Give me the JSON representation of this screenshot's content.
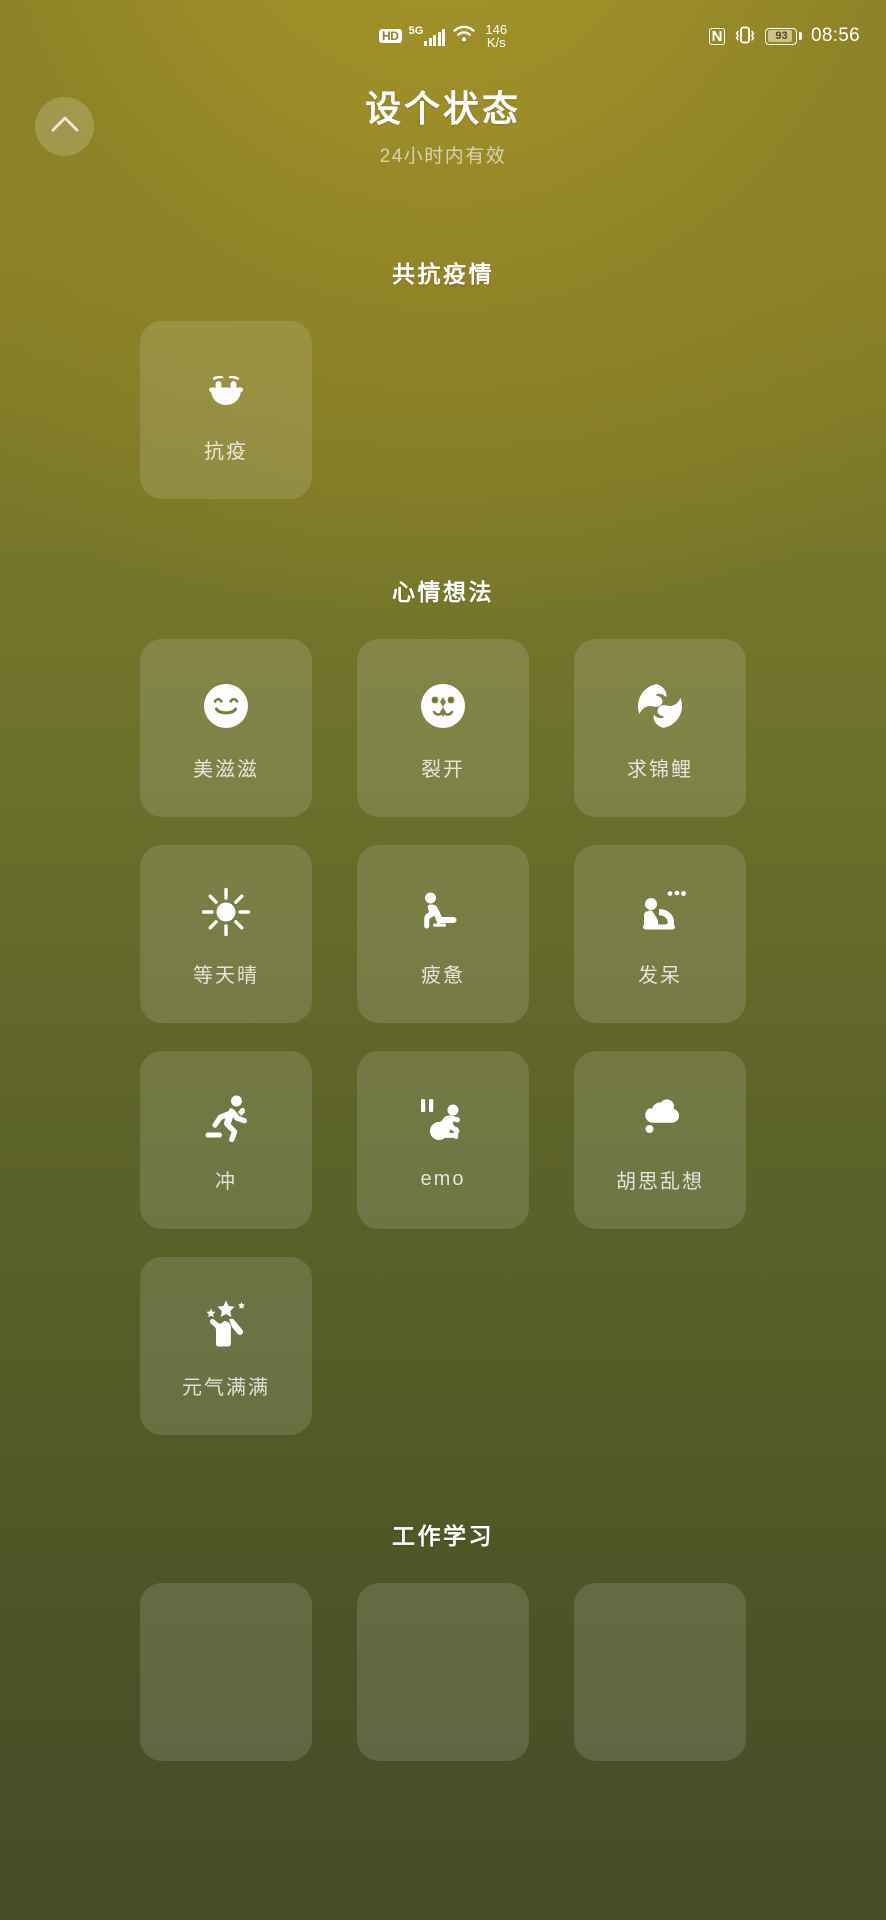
{
  "statusbar": {
    "hd_label": "HD",
    "network_label": "5G",
    "speed_value": "146",
    "speed_unit": "K/s",
    "nfc_label": "N",
    "vibrate_icon": "vibrate-icon",
    "battery_percent": "93",
    "time": "08:56"
  },
  "header": {
    "back_icon": "chevron-up-icon",
    "title": "设个状态",
    "subtitle": "24小时内有效"
  },
  "sections": [
    {
      "title": "共抗疫情",
      "tiles": [
        {
          "label": "抗疫",
          "icon": "face-mask-icon"
        }
      ]
    },
    {
      "title": "心情想法",
      "tiles": [
        {
          "label": "美滋滋",
          "icon": "smiley-face-icon"
        },
        {
          "label": "裂开",
          "icon": "cracked-face-icon"
        },
        {
          "label": "求锦鲤",
          "icon": "koi-fish-icon"
        },
        {
          "label": "等天晴",
          "icon": "sun-icon"
        },
        {
          "label": "疲惫",
          "icon": "tired-person-icon"
        },
        {
          "label": "发呆",
          "icon": "daydream-person-icon"
        },
        {
          "label": "冲",
          "icon": "running-person-icon"
        },
        {
          "label": "emo",
          "icon": "crouching-person-icon"
        },
        {
          "label": "胡思乱想",
          "icon": "thought-bubble-icon"
        },
        {
          "label": "元气满满",
          "icon": "sparkle-person-icon"
        }
      ]
    },
    {
      "title": "工作学习",
      "tiles": []
    }
  ],
  "colors": {
    "gradient_top": "#958626",
    "gradient_bottom": "#454d27",
    "tile_bg": "rgba(255,255,255,0.13)",
    "text_primary": "#ffffff",
    "battery_fill": "#cfc38a"
  }
}
